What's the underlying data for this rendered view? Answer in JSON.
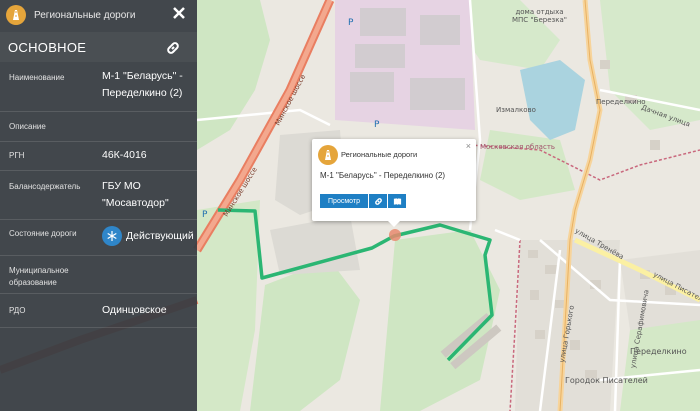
{
  "panel": {
    "title": "Региональные дороги",
    "section_title": "ОСНОВНОЕ",
    "fields": [
      {
        "label": "Наименование",
        "value": "М-1 \"Беларусь\" - Переделкино (2)"
      },
      {
        "label": "Описание",
        "value": ""
      },
      {
        "label": "РГН",
        "value": "46К-4016"
      },
      {
        "label": "Балансодержатель",
        "value": "ГБУ МО \"Мосавтодор\""
      },
      {
        "label": "Состояние дороги",
        "value": "Действующий"
      },
      {
        "label": "Муниципальное образование",
        "value": ""
      },
      {
        "label": "РДО",
        "value": "Одинцовское"
      }
    ]
  },
  "popup": {
    "title": "Региональные дороги",
    "road_name": "М-1 \"Беларусь\" - Переделкино (2)",
    "view_button": "Просмотр",
    "close_symbol": "×"
  },
  "map_labels": {
    "sanatorium": "дома отдыха\nМПС \"Березка\"",
    "izmalkovo": "Измалково",
    "peredelkino_top": "Переделкино",
    "peredelkino_bottom": "Переделкино",
    "gorodok": "Городок Писателей",
    "ul_trenieva": "улица Тренёва",
    "minskoe_1": "Минское шоссе",
    "minskoe_2": "Минское шоссе",
    "moskovskaya_oblast": "Московская область",
    "parking_1": "P",
    "parking_2": "P",
    "parking_3": "P",
    "ul_gorkogo": "улица Горького",
    "ul_serafimovicha": "улица Серафимовича",
    "dachnaya": "Дачная улица",
    "pisateley": "улица Писателей"
  },
  "colors": {
    "route": "#2bb673",
    "panel_bg": "#373d42",
    "accent": "#1e7fc4",
    "layer_icon": "#e5a53b",
    "status_blue": "#2f86c9"
  },
  "icons": {
    "layer": "road-icon",
    "close": "close-icon",
    "link": "link-icon",
    "status": "snowflake-icon",
    "popup_link": "link-icon",
    "popup_book": "book-icon"
  }
}
